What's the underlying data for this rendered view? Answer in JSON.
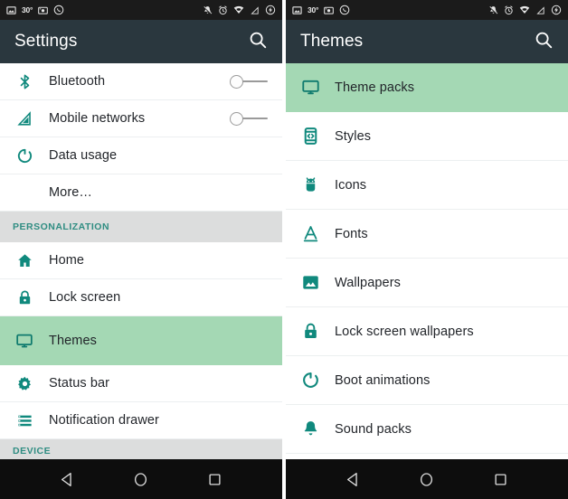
{
  "statusbar": {
    "left_icons": [
      "photo-icon",
      "temperature-text",
      "camera-icon",
      "whatsapp-icon"
    ],
    "temperature": "30°",
    "right_icons": [
      "bell-mute-icon",
      "alarm-clock-icon",
      "wifi-icon",
      "cell-signal-icon",
      "battery-icon"
    ]
  },
  "left_screen": {
    "appbar": {
      "title": "Settings",
      "search_icon": "search-icon"
    },
    "rows": [
      {
        "label": "Bluetooth",
        "icon": "bluetooth-icon",
        "toggle": "off",
        "selected": false
      },
      {
        "label": "Mobile networks",
        "icon": "signal-triangle-icon",
        "toggle": "off",
        "selected": false
      },
      {
        "label": "Data usage",
        "icon": "data-usage-circle-icon",
        "toggle": null,
        "selected": false
      },
      {
        "label": "More…",
        "icon": null,
        "toggle": null,
        "selected": false
      }
    ],
    "section_personalization": "PERSONALIZATION",
    "rows2": [
      {
        "label": "Home",
        "icon": "home-icon",
        "selected": false
      },
      {
        "label": "Lock screen",
        "icon": "lock-icon",
        "selected": false
      },
      {
        "label": "Themes",
        "icon": "monitor-icon",
        "selected": true
      },
      {
        "label": "Status bar",
        "icon": "gear-icon",
        "selected": false
      },
      {
        "label": "Notification drawer",
        "icon": "list-lines-icon",
        "selected": false
      }
    ],
    "section_device": "DEVICE"
  },
  "right_screen": {
    "appbar": {
      "title": "Themes",
      "search_icon": "search-icon"
    },
    "rows": [
      {
        "label": "Theme packs",
        "icon": "monitor-icon",
        "selected": true
      },
      {
        "label": "Styles",
        "icon": "code-brackets-icon",
        "selected": false
      },
      {
        "label": "Icons",
        "icon": "android-robot-icon",
        "selected": false
      },
      {
        "label": "Fonts",
        "icon": "font-a-icon",
        "selected": false
      },
      {
        "label": "Wallpapers",
        "icon": "image-icon",
        "selected": false
      },
      {
        "label": "Lock screen wallpapers",
        "icon": "lock-icon",
        "selected": false
      },
      {
        "label": "Boot animations",
        "icon": "boot-circle-icon",
        "selected": false
      },
      {
        "label": "Sound packs",
        "icon": "bell-icon",
        "selected": false
      }
    ]
  },
  "navbar": {
    "buttons": [
      {
        "name": "back-button",
        "icon": "back-triangle-icon"
      },
      {
        "name": "home-button",
        "icon": "home-circle-icon"
      },
      {
        "name": "recents-button",
        "icon": "recents-square-icon"
      }
    ]
  },
  "colors": {
    "appbar_bg": "#2a373e",
    "statusbar_bg": "#1b1b1b",
    "accent_teal": "#10897d",
    "selected_green": "#a4d8b4",
    "section_bg": "#dcdddd",
    "section_text": "#2f8d82",
    "navbar_bg": "#0d0d0d"
  }
}
